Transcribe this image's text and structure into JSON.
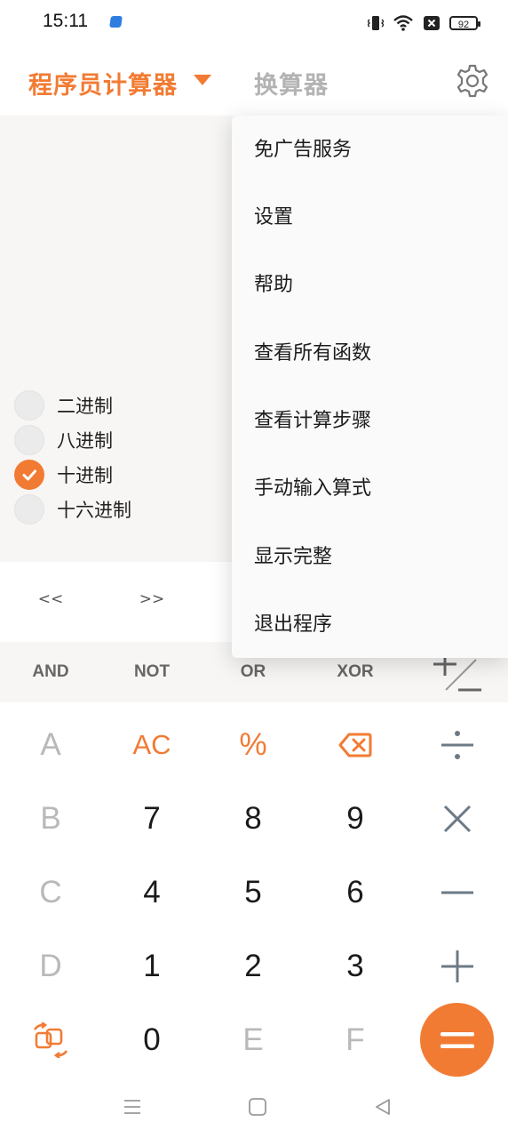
{
  "status": {
    "time": "15:11",
    "battery": "92",
    "icons": [
      "app-notification-icon",
      "vibrate-icon",
      "wifi-icon",
      "no-sim-icon",
      "battery-icon"
    ]
  },
  "header": {
    "mode_tab": "程序员计算器",
    "converter_tab": "换算器",
    "settings_icon": "gear-icon"
  },
  "radix": {
    "options": [
      {
        "label": "二进制",
        "checked": false
      },
      {
        "label": "八进制",
        "checked": false
      },
      {
        "label": "十进制",
        "checked": true
      },
      {
        "label": "十六进制",
        "checked": false
      }
    ]
  },
  "keypad": {
    "shift": [
      "<<",
      ">>"
    ],
    "logic": [
      "AND",
      "NOT",
      "OR",
      "XOR"
    ],
    "rows": [
      [
        "A",
        "AC",
        "%",
        "⌫",
        "÷"
      ],
      [
        "B",
        "7",
        "8",
        "9",
        "×"
      ],
      [
        "C",
        "4",
        "5",
        "6",
        "−"
      ],
      [
        "D",
        "1",
        "2",
        "3",
        "+"
      ],
      [
        "⇄",
        "0",
        "E",
        "F",
        "="
      ]
    ]
  },
  "menu": {
    "items": [
      "免广告服务",
      "设置",
      "帮助",
      "查看所有函数",
      "查看计算步骤",
      "手动输入算式",
      "显示完整",
      "退出程序"
    ]
  },
  "colors": {
    "accent": "#f27b33",
    "display_bg": "#f8f6f4",
    "disabled_key": "#b9b9b9",
    "operator": "#6c7a86"
  }
}
